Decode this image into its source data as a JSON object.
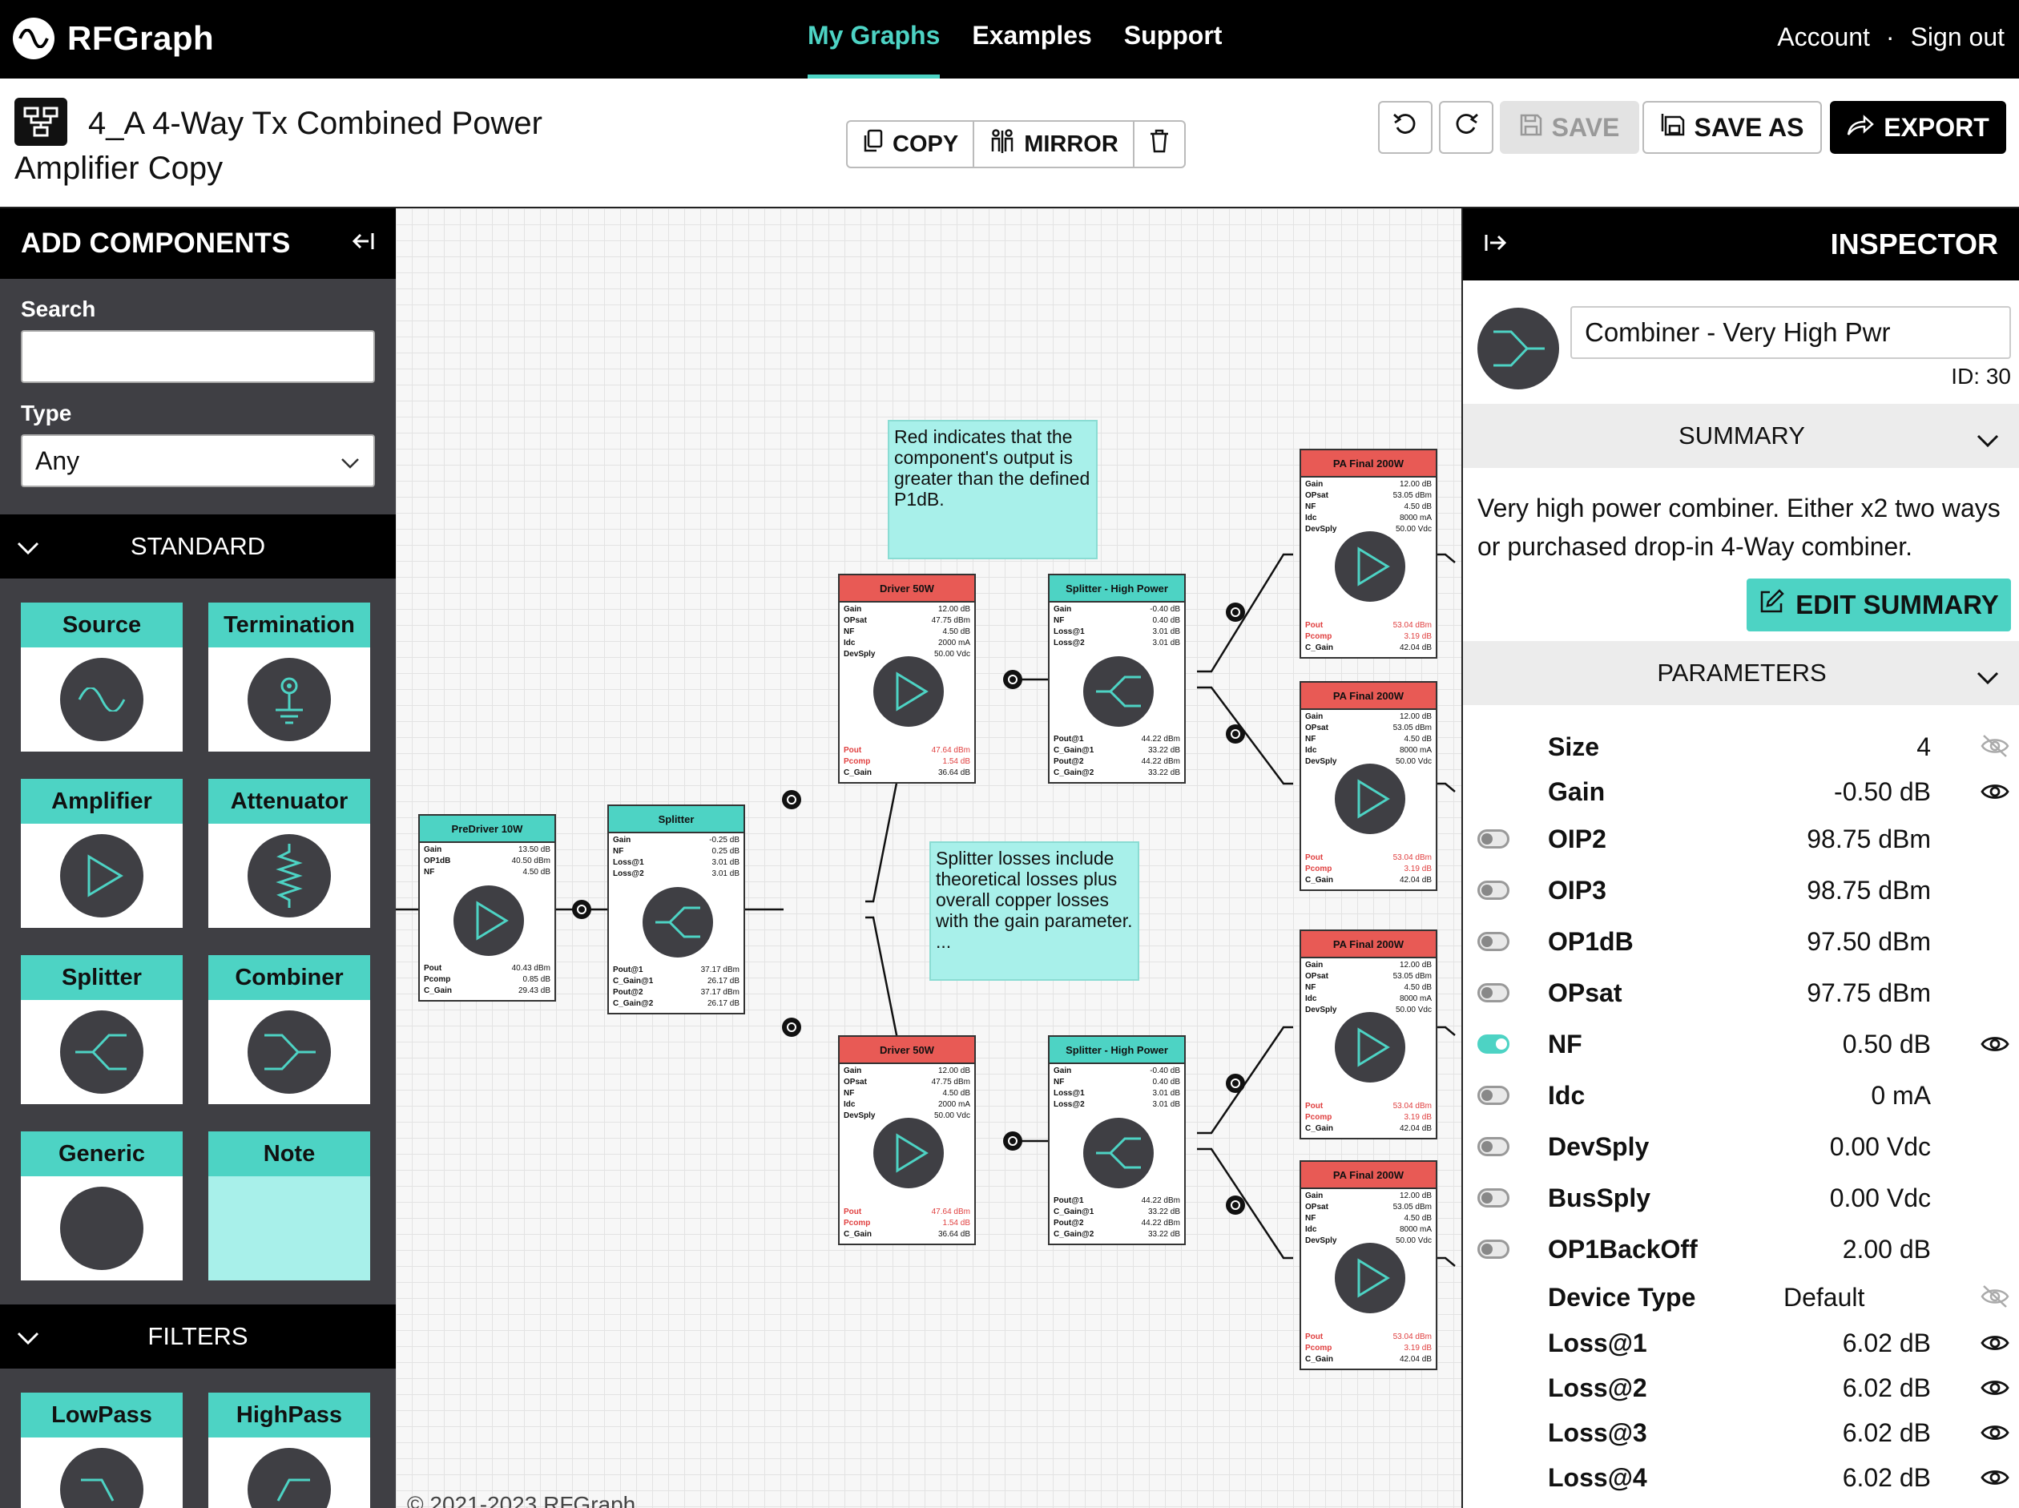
{
  "nav": {
    "brand": "RFGraph",
    "links": [
      "My Graphs",
      "Examples",
      "Support"
    ],
    "account": "Account",
    "separator": "·",
    "signout": "Sign out"
  },
  "titlebar": {
    "title": "4_A 4-Way Tx Combined Power Amplifier Copy",
    "copy": "COPY",
    "mirror": "MIRROR",
    "save": "SAVE",
    "save_as": "SAVE AS",
    "export": "EXPORT"
  },
  "left": {
    "header": "ADD COMPONENTS",
    "search_label": "Search",
    "search_value": "",
    "type_label": "Type",
    "type_value": "Any",
    "standard": "STANDARD",
    "components": [
      "Source",
      "Termination",
      "Amplifier",
      "Attenuator",
      "Splitter",
      "Combiner",
      "Generic",
      "Note"
    ],
    "filters": "FILTERS",
    "filter_components": [
      "LowPass",
      "HighPass"
    ]
  },
  "canvas": {
    "notes": [
      "Red indicates that the component's output is greater than the defined P1dB.",
      "Splitter losses include theoretical losses plus overall copper losses with the gain parameter. ..."
    ],
    "copyright": "© 2021-2023 RFGraph",
    "nodes": {
      "predriver": {
        "title": "PreDriver 10W",
        "top": [
          [
            "Gain",
            "13.50 dB"
          ],
          [
            "OP1dB",
            "40.50 dBm"
          ],
          [
            "NF",
            "4.50 dB"
          ]
        ],
        "bottom": [
          [
            "Pout",
            "40.43 dBm"
          ],
          [
            "Pcomp",
            "0.85 dB"
          ],
          [
            "C_Gain",
            "29.43 dB"
          ]
        ]
      },
      "splitter1": {
        "title": "Splitter",
        "top": [
          [
            "Gain",
            "-0.25 dB"
          ],
          [
            "NF",
            "0.25 dB"
          ],
          [
            "Loss@1",
            "3.01 dB"
          ],
          [
            "Loss@2",
            "3.01 dB"
          ]
        ],
        "bottom": [
          [
            "Pout@1",
            "37.17 dBm"
          ],
          [
            "C_Gain@1",
            "26.17 dB"
          ],
          [
            "Pout@2",
            "37.17 dBm"
          ],
          [
            "C_Gain@2",
            "26.17 dB"
          ]
        ]
      },
      "driver": {
        "title": "Driver 50W",
        "top": [
          [
            "Gain",
            "12.00 dB"
          ],
          [
            "OPsat",
            "47.75 dBm"
          ],
          [
            "NF",
            "4.50 dB"
          ],
          [
            "Idc",
            "2000 mA"
          ],
          [
            "DevSply",
            "50.00 Vdc"
          ]
        ],
        "bottom": [
          [
            "Pout",
            "47.64 dBm"
          ],
          [
            "Pcomp",
            "1.54 dB"
          ],
          [
            "C_Gain",
            "36.64 dB"
          ]
        ]
      },
      "splitterhp": {
        "title": "Splitter - High Power",
        "top": [
          [
            "Gain",
            "-0.40 dB"
          ],
          [
            "NF",
            "0.40 dB"
          ],
          [
            "Loss@1",
            "3.01 dB"
          ],
          [
            "Loss@2",
            "3.01 dB"
          ]
        ],
        "bottom": [
          [
            "Pout@1",
            "44.22 dBm"
          ],
          [
            "C_Gain@1",
            "33.22 dB"
          ],
          [
            "Pout@2",
            "44.22 dBm"
          ],
          [
            "C_Gain@2",
            "33.22 dB"
          ]
        ]
      },
      "pafinal": {
        "title": "PA Final 200W",
        "top": [
          [
            "Gain",
            "12.00 dB"
          ],
          [
            "OPsat",
            "53.05 dBm"
          ],
          [
            "NF",
            "4.50 dB"
          ],
          [
            "Idc",
            "8000 mA"
          ],
          [
            "DevSply",
            "50.00 Vdc"
          ]
        ],
        "bottom": [
          [
            "Pout",
            "53.04 dBm"
          ],
          [
            "Pcomp",
            "3.19 dB"
          ],
          [
            "C_Gain",
            "42.04 dB"
          ]
        ]
      }
    }
  },
  "inspector": {
    "header": "INSPECTOR",
    "name": "Combiner - Very High Pwr",
    "id": "ID: 30",
    "summary_header": "SUMMARY",
    "summary": "Very high power combiner.  Either x2 two ways or purchased drop-in 4-Way combiner.",
    "edit_summary": "EDIT SUMMARY",
    "parameters_header": "PARAMETERS",
    "params": [
      {
        "name": "Size",
        "value": "4"
      },
      {
        "name": "Gain",
        "value": "-0.50 dB"
      },
      {
        "name": "OIP2",
        "value": "98.75 dBm"
      },
      {
        "name": "OIP3",
        "value": "98.75 dBm"
      },
      {
        "name": "OP1dB",
        "value": "97.50 dBm"
      },
      {
        "name": "OPsat",
        "value": "97.75 dBm"
      },
      {
        "name": "NF",
        "value": "0.50 dB"
      },
      {
        "name": "Idc",
        "value": "0 mA"
      },
      {
        "name": "DevSply",
        "value": "0.00 Vdc"
      },
      {
        "name": "BusSply",
        "value": "0.00 Vdc"
      },
      {
        "name": "OP1BackOff",
        "value": "2.00 dB"
      },
      {
        "name": "Device Type",
        "value": "Default"
      },
      {
        "name": "Loss@1",
        "value": "6.02 dB"
      },
      {
        "name": "Loss@2",
        "value": "6.02 dB"
      },
      {
        "name": "Loss@3",
        "value": "6.02 dB"
      },
      {
        "name": "Loss@4",
        "value": "6.02 dB"
      }
    ]
  }
}
